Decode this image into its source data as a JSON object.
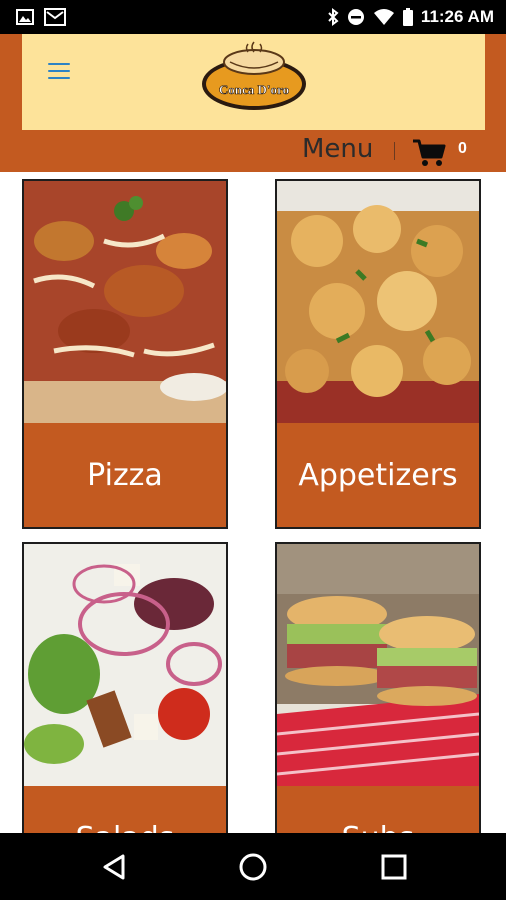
{
  "status_bar": {
    "time": "11:26 AM",
    "icons": [
      "image-icon",
      "mail-icon",
      "bluetooth-icon",
      "do-not-disturb-icon",
      "wifi-icon",
      "battery-icon"
    ]
  },
  "header": {
    "logo_text": "Conca D'oro",
    "menu_label": "Menu",
    "cart_count": "0",
    "colors": {
      "brand": "#c35a20",
      "logo_panel": "#fde39a",
      "hamburger": "#2d83c5"
    }
  },
  "categories": [
    {
      "label": "Pizza",
      "image": "pizza"
    },
    {
      "label": "Appetizers",
      "image": "garlic-knots"
    },
    {
      "label": "Salads",
      "image": "salad"
    },
    {
      "label": "Subs",
      "image": "sub-sandwich"
    }
  ],
  "nav_bar": {
    "buttons": [
      "back-icon",
      "home-icon",
      "recents-icon"
    ]
  }
}
